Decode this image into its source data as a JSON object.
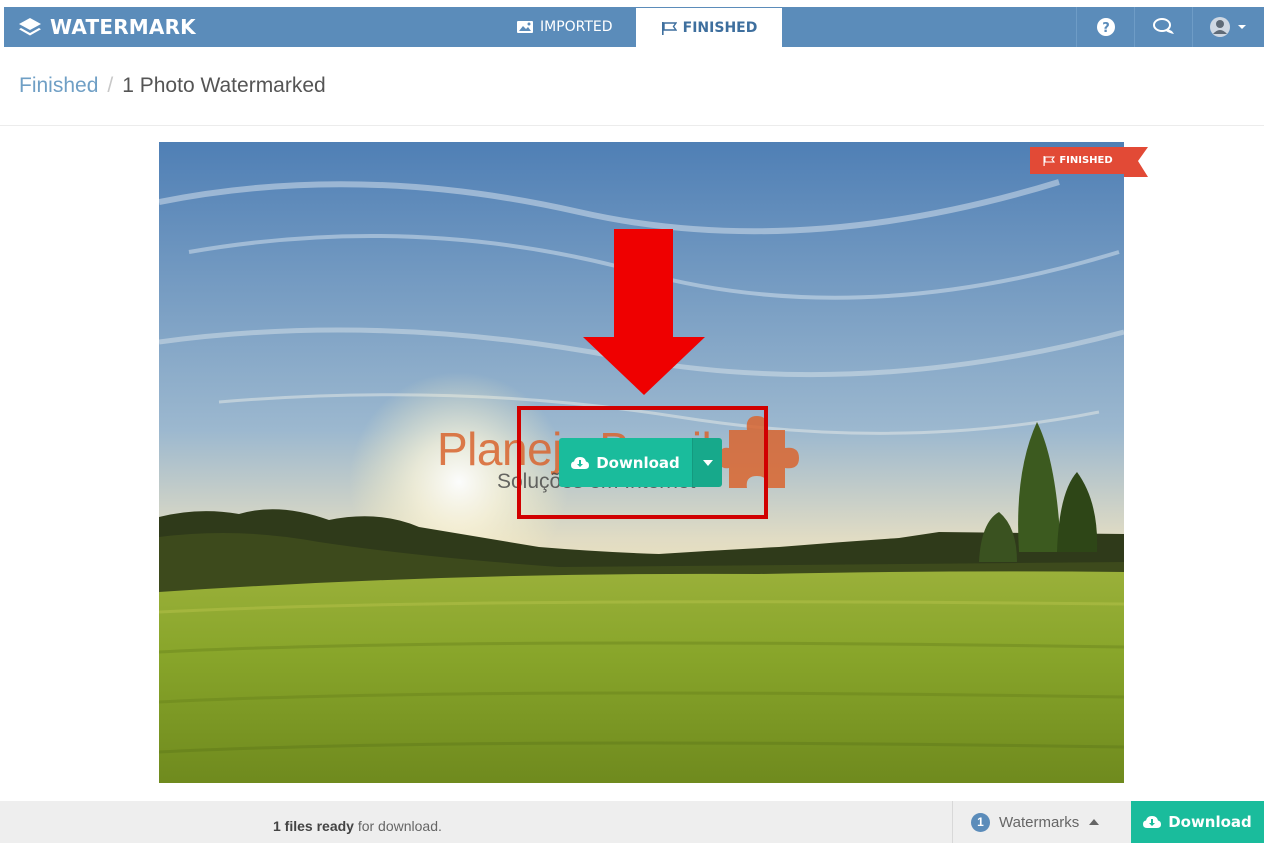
{
  "app": {
    "name": "WATERMARK",
    "brand_icon": "layers-icon"
  },
  "tabs": [
    {
      "label": "IMPORTED",
      "icon": "images-icon",
      "active": false
    },
    {
      "label": "FINISHED",
      "icon": "flag-icon",
      "active": true
    }
  ],
  "topbar_icons": [
    "help-icon",
    "chat-icon",
    "user-icon"
  ],
  "breadcrumb": {
    "parent": "Finished",
    "separator": "/",
    "current": "1 Photo Watermarked"
  },
  "photo": {
    "status_ribbon": "FINISHED",
    "watermark_title": "Planeja Brasil",
    "watermark_subtitle": "Soluções em Internet",
    "download_label": "Download"
  },
  "footer": {
    "ready_count": "1 files ready",
    "ready_suffix": " for download.",
    "watermarks_count": "1",
    "watermarks_label": "Watermarks",
    "download_label": "Download"
  },
  "colors": {
    "topbar": "#5b8cba",
    "accent": "#1abc9c",
    "ribbon": "#e24a36",
    "highlight": "#d10000"
  }
}
